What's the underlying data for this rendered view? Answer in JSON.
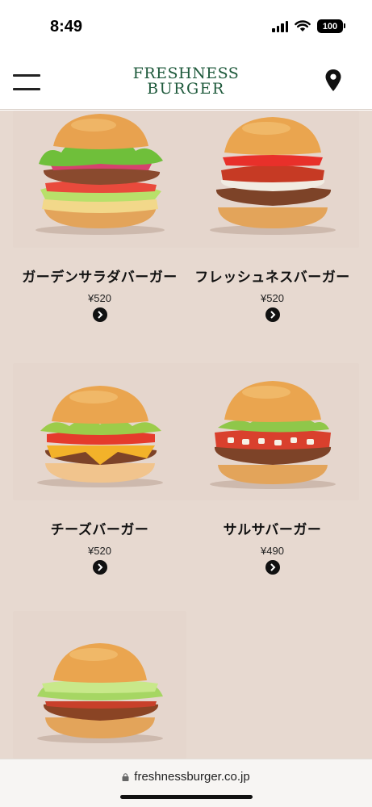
{
  "status_bar": {
    "time": "8:49",
    "battery": "100"
  },
  "header": {
    "logo_line1": "FRESHNESS",
    "logo_line2": "BURGER",
    "menu_icon": "hamburger-menu-icon",
    "location_icon": "map-pin-icon",
    "brand_color": "#1f5a3c"
  },
  "menu_items": [
    {
      "name": "ガーデンサラダバーガー",
      "price": "¥520",
      "image_icon": "garden-salad-burger-image"
    },
    {
      "name": "フレッシュネスバーガー",
      "price": "¥520",
      "image_icon": "freshness-burger-image"
    },
    {
      "name": "チーズバーガー",
      "price": "¥520",
      "image_icon": "cheese-burger-image"
    },
    {
      "name": "サルサバーガー",
      "price": "¥490",
      "image_icon": "salsa-burger-image"
    },
    {
      "name": "",
      "price": "",
      "image_icon": "teriyaki-burger-image"
    }
  ],
  "browser": {
    "url": "freshnessburger.co.jp",
    "lock_icon": "lock-icon"
  },
  "colors": {
    "background": "#e7d9d0",
    "text": "#111111"
  }
}
